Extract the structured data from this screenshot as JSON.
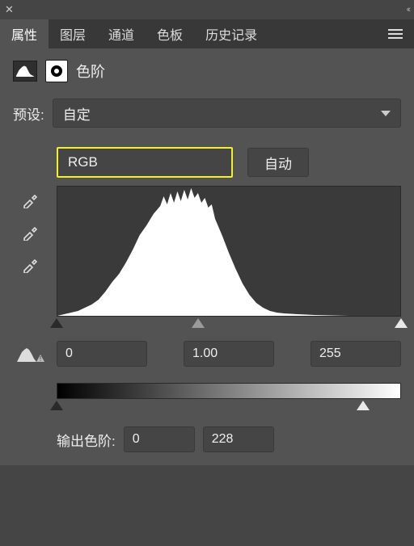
{
  "topbar": {
    "close": "✕",
    "collapse": "‹‹"
  },
  "tabs": {
    "items": [
      "属性",
      "图层",
      "通道",
      "色板",
      "历史记录"
    ],
    "active": 0
  },
  "panel": {
    "title": "色阶",
    "preset_label": "预设:",
    "preset_value": "自定",
    "channel_value": "RGB",
    "auto_label": "自动",
    "input_black": "0",
    "input_gamma": "1.00",
    "input_white": "255",
    "output_label": "输出色阶:",
    "output_black": "0",
    "output_white": "228"
  },
  "slider_positions": {
    "in_black_pct": 0,
    "in_gamma_pct": 41,
    "in_white_pct": 100,
    "out_black_pct": 0,
    "out_white_pct": 89
  }
}
